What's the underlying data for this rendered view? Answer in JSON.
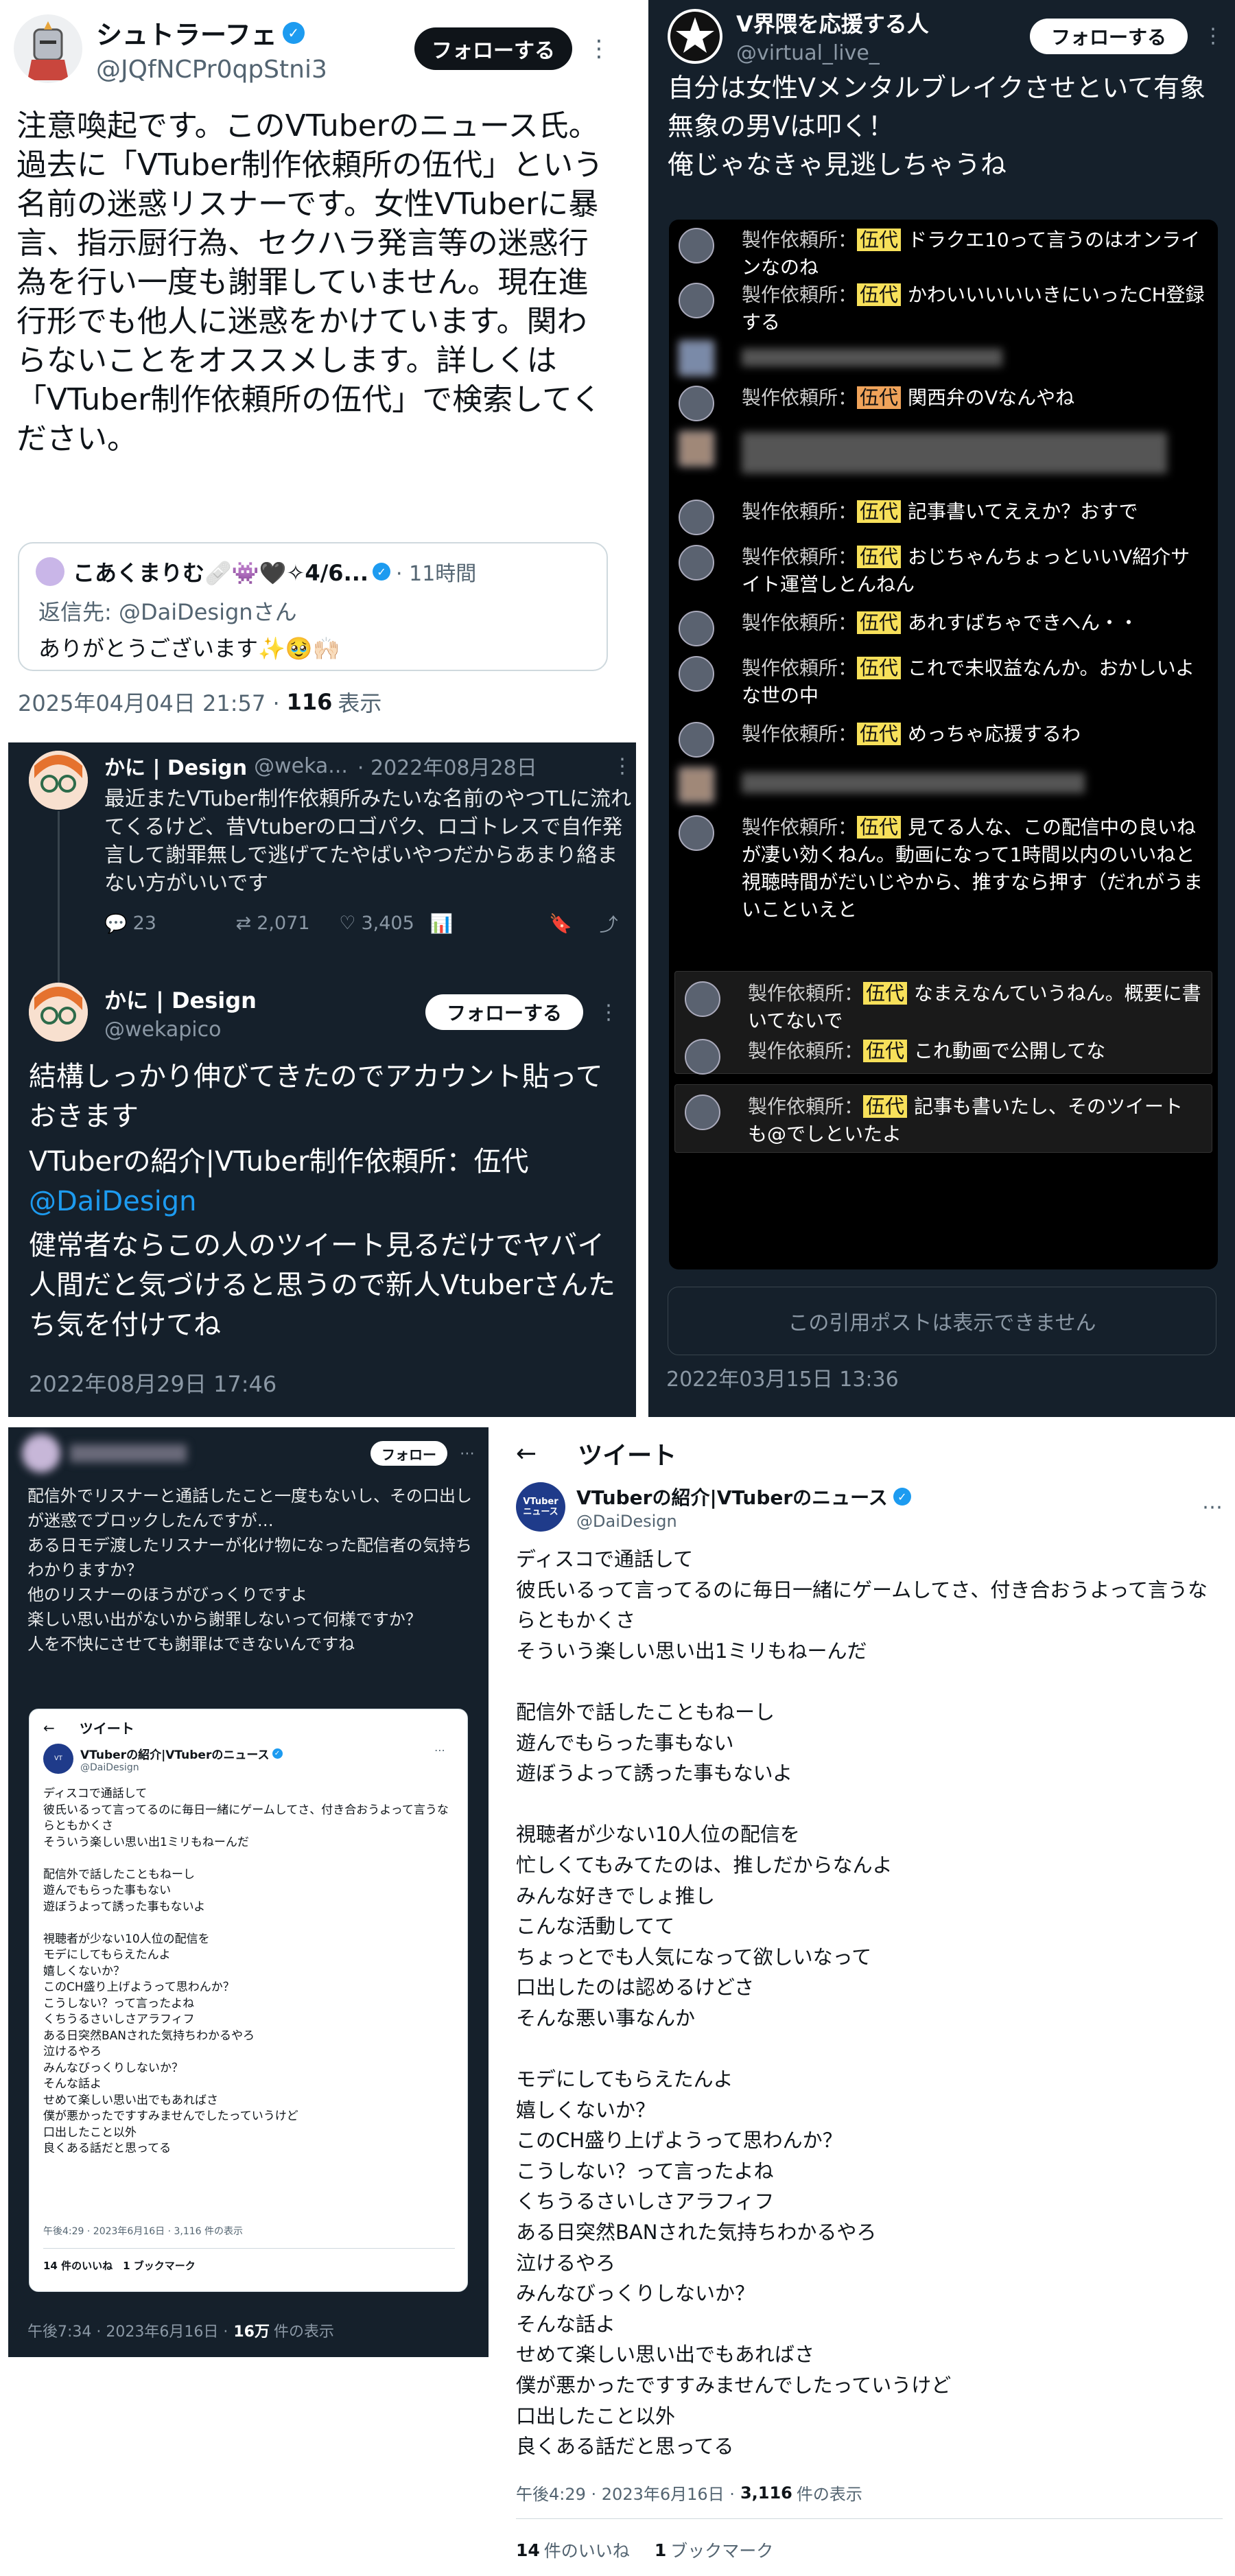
{
  "p1": {
    "display_name": "シュトラーフェ",
    "handle": "@JQfNCPr0qpStni3",
    "follow": "フォローする",
    "body": "注意喚起です。このVTuberのニュース氏。過去に「VTuber制作依頼所の伍代」という名前の迷惑リスナーです。女性VTuberに暴言、指示厨行為、セクハラ発言等の迷惑行為を行い一度も謝罪していません。現在進行形でも他人に迷惑をかけています。関わらないことをオススメします。詳しくは「VTuber制作依頼所の伍代」で検索してください。",
    "quote_name": "こあくまりむ🩹👾🖤✧4/6...",
    "quote_time": "· 11時間",
    "reply_label": "返信先: @DaiDesignさん",
    "quote_body": "ありがとうございます✨🥹🙌🏻",
    "timestamp": "2025年04月04日 21:57 ·",
    "views_num": "116",
    "views_label": "表示"
  },
  "p2": {
    "display_name": "V界隈を応援する人",
    "handle": "@virtual_live_",
    "follow": "フォローする",
    "body": "自分は女性Vメンタルブレイクさせといて有象無象の男Vは叩く！\n俺じゃなきゃ見逃しちゃうね",
    "prefix": "製作依頼所：",
    "tag": "伍代",
    "messages": [
      "ドラクエ10って言うのはオンラインなのね",
      "かわいいいいいきにいったCH登録する",
      "関西弁のVなんやね",
      "記事書いてええか？おすで",
      "おじちゃんちょっといいV紹介サイト運営しとんねん",
      "あれすばちゃできへん・・",
      "これで未収益なんか。おかしいよな世の中",
      "めっちゃ応援するわ",
      "見てる人な、この配信中の良いねが凄い効くねん。動画になって1時間以内のいいねと視聴時間がだいじやから、推すなら押す（だれがうまいこといえと",
      "なまえなんていうねん。概要に書いてないで",
      "これ動画で公開してな",
      "記事も書いたし、そのツイートも@でしといたよ"
    ],
    "unavailable": "この引用ポストは表示できません",
    "timestamp": "2022年03月15日 13:36"
  },
  "p3": {
    "top_name": "かに | Design",
    "top_handle": "@weka...",
    "top_date": "· 2022年08月28日",
    "top_body": "最近またVTuber制作依頼所みたいな名前のやつTLに流れてくるけど、昔Vtuberのロゴパク、ロゴトレスで自作発言して謝罪無しで逃げてたやばいやつだからあまり絡まない方がいいです",
    "replies": "23",
    "retweets": "2,071",
    "likes": "3,405",
    "name": "かに | Design",
    "handle": "@wekapico",
    "follow": "フォローする",
    "body1": "結構しっかり伸びてきたのでアカウント貼っておきます",
    "body2": "VTuberの紹介|VTuber制作依頼所：伍代",
    "mention": "@DaiDesign",
    "body3": "健常者ならこの人のツイート見るだけでヤバイ人間だと気づけると思うので新人Vtuberさんたち気を付けてね",
    "timestamp": "2022年08月29日 17:46"
  },
  "p4": {
    "follow": "フォロー",
    "body": "配信外でリスナーと通話したこと一度もないし、その口出しが迷惑でブロックしたんですが…\nある日モデ渡したリスナーが化け物になった配信者の気持ちわかりますか？\n他のリスナーのほうがびっくりですよ\n楽しい思い出がないから謝罪しないって何様ですか？\n人を不快にさせても謝罪はできないんですね",
    "inner_header": "ツイート",
    "inner_name": "VTuberの紹介|VTuberのニュース",
    "inner_handle": "@DaiDesign",
    "inner_body": "ディスコで通話して\n彼氏いるって言ってるのに毎日一緒にゲームしてさ、付き合おうよって言うならともかくさ\nそういう楽しい思い出1ミリもねーんだ\n\n配信外で話したこともねーし\n遊んでもらった事もない\n遊ぼうよって誘った事もないよ\n\n視聴者が少ない10人位の配信を\nモデにしてもらえたんよ\n嬉しくないか？\nこのCH盛り上げようって思わんか？\nこうしない？って言ったよね\nくちうるさいしさアラフィフ\nある日突然BANされた気持ちわかるやろ\n泣けるやろ\nみんなびっくりしないか？\nそんな話よ\nせめて楽しい思い出でもあればさ\n僕が悪かったですすみませんでしたっていうけど\n口出したこと以外\n良くある話だと思ってる",
    "inner_time": "午後4:29 · 2023年6月16日 · 3,116 件の表示",
    "inner_likes": "14 件のいいね　1 ブックマーク",
    "timestamp": "午後7:34 · 2023年6月16日 ·",
    "views_num": "16万",
    "views_label": "件の表示"
  },
  "p5": {
    "header": "ツイート",
    "name": "VTuberの紹介|VTuberのニュース",
    "handle": "@DaiDesign",
    "avatar_text": "VTuber\nニュース",
    "body": "ディスコで通話して\n彼氏いるって言ってるのに毎日一緒にゲームしてさ、付き合おうよって言うならともかくさ\nそういう楽しい思い出1ミリもねーんだ\n\n配信外で話したこともねーし\n遊んでもらった事もない\n遊ぼうよって誘った事もないよ\n\n視聴者が少ない10人位の配信を\n忙しくてもみてたのは、推しだからなんよ\nみんな好きでしょ推し\nこんな活動してて\nちょっとでも人気になって欲しいなって\n口出したのは認めるけどさ\nそんな悪い事なんか\n\nモデにしてもらえたんよ\n嬉しくないか？\nこのCH盛り上げようって思わんか？\nこうしない？って言ったよね\nくちうるさいしさアラフィフ\nある日突然BANされた気持ちわかるやろ\n泣けるやろ\nみんなびっくりしないか？\nそんな話よ\nせめて楽しい思い出でもあればさ\n僕が悪かったですすみませんでしたっていうけど\n口出したこと以外\n良くある話だと思ってる",
    "time_prefix": "午後4:29 · 2023年6月16日 ·",
    "views_num": "3,116",
    "views_label": "件の表示",
    "likes_num": "14",
    "likes_label": "件のいいね",
    "bm_num": "1",
    "bm_label": "ブックマーク"
  },
  "colors": {
    "accent": "#1d9bf0",
    "dark_bg": "#15202b",
    "highlight": "#f7e05a"
  }
}
